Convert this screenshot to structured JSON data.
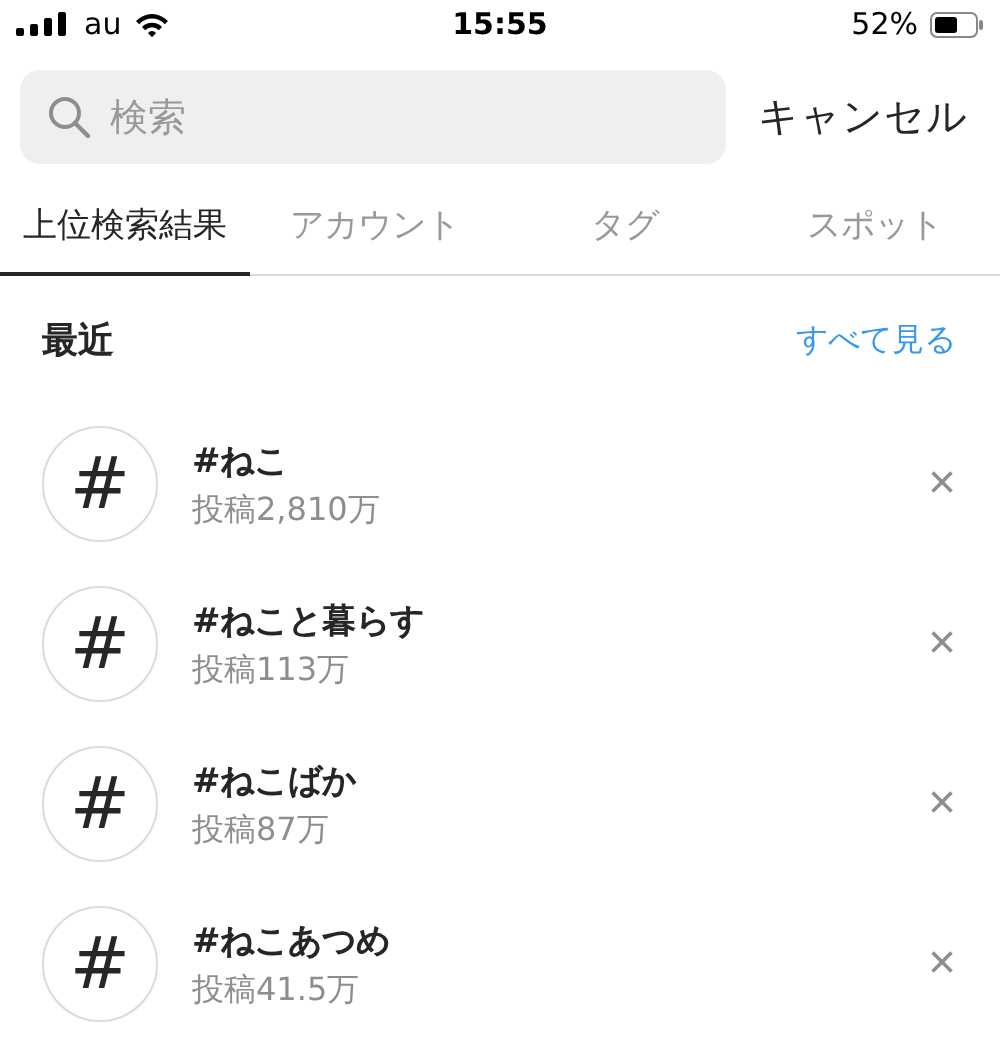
{
  "status_bar": {
    "carrier": "au",
    "time": "15:55",
    "battery": "52%"
  },
  "search": {
    "placeholder": "検索",
    "cancel": "キャンセル"
  },
  "tabs": [
    {
      "label": "上位検索結果",
      "selected": true
    },
    {
      "label": "アカウント",
      "selected": false
    },
    {
      "label": "タグ",
      "selected": false
    },
    {
      "label": "スポット",
      "selected": false
    }
  ],
  "recent": {
    "title": "最近",
    "see_all": "すべて見る",
    "items": [
      {
        "icon": "#",
        "name": "#ねこ",
        "posts": "投稿2,810万",
        "remove": "×"
      },
      {
        "icon": "#",
        "name": "#ねこと暮らす",
        "posts": "投稿113万",
        "remove": "×"
      },
      {
        "icon": "#",
        "name": "#ねこばか",
        "posts": "投稿87万",
        "remove": "×"
      },
      {
        "icon": "#",
        "name": "#ねこあつめ",
        "posts": "投稿41.5万",
        "remove": "×"
      }
    ]
  }
}
